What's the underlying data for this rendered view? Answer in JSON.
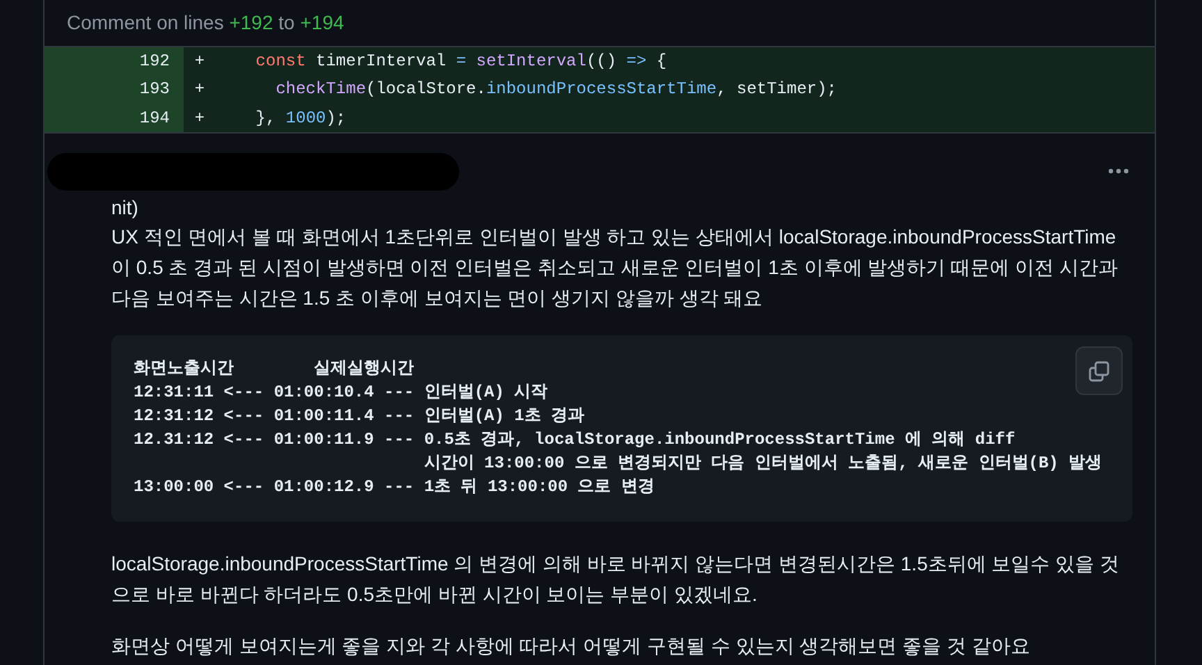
{
  "comment_range": {
    "prefix": "Comment on lines",
    "start": "+192",
    "middle": "to",
    "end": "+194"
  },
  "diff_lines": [
    {
      "number": "192",
      "sign": "+",
      "tokens": [
        {
          "kind": "keyword",
          "text": "    const"
        },
        {
          "kind": "plain",
          "text": " timerInterval "
        },
        {
          "kind": "operator",
          "text": "= "
        },
        {
          "kind": "function",
          "text": "setInterval"
        },
        {
          "kind": "plain",
          "text": "(() "
        },
        {
          "kind": "operator",
          "text": "=>"
        },
        {
          "kind": "plain",
          "text": " {"
        }
      ]
    },
    {
      "number": "193",
      "sign": "+",
      "tokens": [
        {
          "kind": "function",
          "text": "      checkTime"
        },
        {
          "kind": "plain",
          "text": "(localStore."
        },
        {
          "kind": "property",
          "text": "inboundProcessStartTime"
        },
        {
          "kind": "plain",
          "text": ", setTimer);"
        }
      ]
    },
    {
      "number": "194",
      "sign": "+",
      "tokens": [
        {
          "kind": "plain",
          "text": "    }, "
        },
        {
          "kind": "number",
          "text": "1000"
        },
        {
          "kind": "plain",
          "text": ");"
        }
      ]
    }
  ],
  "comment": {
    "blocks": [
      {
        "kind": "text",
        "lines": [
          "nit)",
          "UX 적인 면에서 볼 때 화면에서 1초단위로 인터벌이 발생 하고 있는 상태에서 localStorage.inboundProcessStartTime 이 0.5 초 경과 된 시점이 발생하면 이전 인터벌은 취소되고 새로운 인터벌이 1초 이후에 발생하기 때문에 이전 시간과 다음 보여주는 시간은 1.5 초 이후에 보여지는 면이 생기지 않을까 생각 돼요"
        ]
      },
      {
        "kind": "code",
        "lines": [
          "화면노출시간        실제실행시간",
          "12:31:11 <--- 01:00:10.4 --- 인터벌(A) 시작",
          "12:31:12 <--- 01:00:11.4 --- 인터벌(A) 1초 경과",
          "12.31:12 <--- 01:00:11.9 --- 0.5초 경과, localStorage.inboundProcessStartTime 에 의해 diff",
          "                             시간이 13:00:00 으로 변경되지만 다음 인터벌에서 노출됨, 새로운 인터벌(B) 발생",
          "13:00:00 <--- 01:00:12.9 --- 1초 뒤 13:00:00 으로 변경"
        ]
      },
      {
        "kind": "text",
        "lines": [
          "localStorage.inboundProcessStartTime 의 변경에 의해 바로 바뀌지 않는다면 변경된시간은 1.5초뒤에 보일수 있을 것으로 바로 바뀐다 하더라도 0.5초만에 바뀐 시간이 보이는 부분이 있겠네요."
        ]
      },
      {
        "kind": "text",
        "lines": [
          "화면상 어떻게 보여지는게 좋을 지와 각 사항에 따라서 어떻게 구현될 수 있는지 생각해보면 좋을 것 같아요"
        ]
      }
    ]
  }
}
